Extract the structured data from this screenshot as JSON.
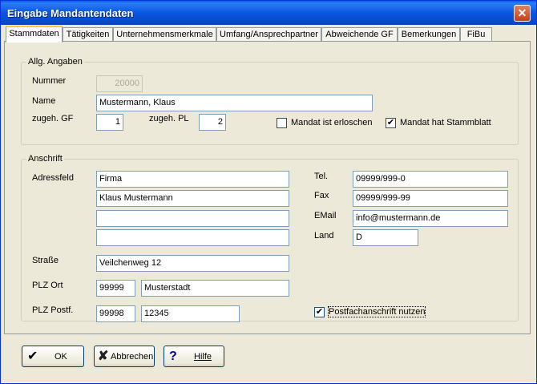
{
  "window": {
    "title": "Eingabe Mandantendaten",
    "close_symbol": "✕"
  },
  "tabs": [
    {
      "label": "Stammdaten",
      "active": true
    },
    {
      "label": "Tätigkeiten"
    },
    {
      "label": "Unternehmensmerkmale"
    },
    {
      "label": "Umfang/Ansprechpartner"
    },
    {
      "label": "Abweichende GF"
    },
    {
      "label": "Bemerkungen"
    },
    {
      "label": "FiBu"
    }
  ],
  "allg": {
    "group_label": "Allg. Angaben",
    "nummer_label": "Nummer",
    "nummer_value": "20000",
    "name_label": "Name",
    "name_value": "Mustermann, Klaus",
    "gf_label": "zugeh. GF",
    "gf_value": "1",
    "pl_label": "zugeh. PL",
    "pl_value": "2",
    "erloschen_label": "Mandat ist erloschen",
    "erloschen_checked": false,
    "stammblatt_label": "Mandat hat Stammblatt",
    "stammblatt_checked": true
  },
  "anschrift": {
    "group_label": "Anschrift",
    "adressfeld_label": "Adressfeld",
    "adress_lines": [
      "Firma",
      "Klaus Mustermann",
      "",
      ""
    ],
    "strasse_label": "Straße",
    "strasse_value": "Veilchenweg 12",
    "plz_ort_label": "PLZ Ort",
    "plz_value": "99999",
    "ort_value": "Musterstadt",
    "plz_postf_label": "PLZ Postf.",
    "plz_postf_value": "99998",
    "postfach_value": "12345",
    "tel_label": "Tel.",
    "tel_value": "09999/999-0",
    "fax_label": "Fax",
    "fax_value": "09999/999-99",
    "email_label": "EMail",
    "email_value": "info@mustermann.de",
    "land_label": "Land",
    "land_value": "D",
    "postfach_nutzen_label": "Postfachanschrift nutzen",
    "postfach_nutzen_checked": true
  },
  "buttons": {
    "ok_label": "OK",
    "ok_icon": "checkmark-icon",
    "abbrechen_label": "Abbrechen",
    "abbrechen_icon": "x-icon",
    "hilfe_label": "Hilfe",
    "hilfe_icon": "question-icon"
  }
}
